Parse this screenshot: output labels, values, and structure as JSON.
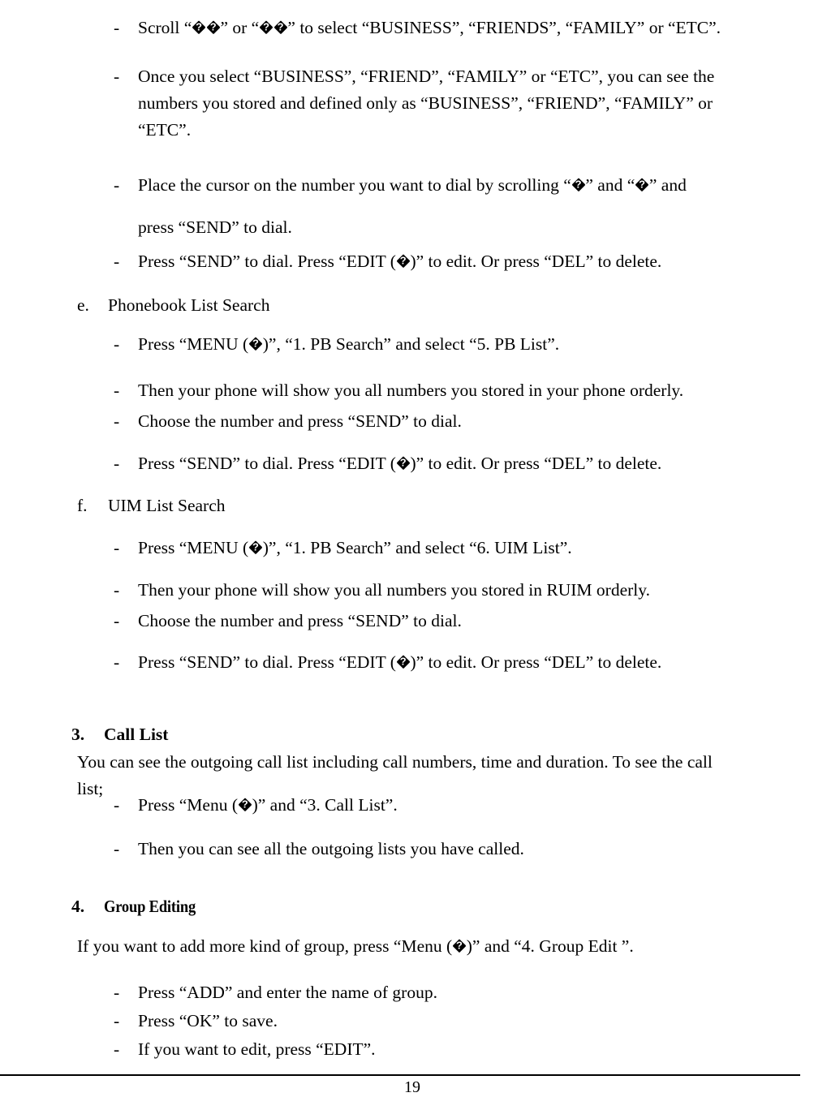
{
  "document": {
    "page_number": "19",
    "replacement_glyph": "�"
  },
  "body": {
    "items": [
      {
        "id": "scroll-select-group",
        "kind": "dash",
        "marker": "-",
        "segments": [
          {
            "t": "text",
            "v": "Scroll “"
          },
          {
            "t": "glyph"
          },
          {
            "t": "glyph"
          },
          {
            "t": "text",
            "v": "” or “"
          },
          {
            "t": "glyph"
          },
          {
            "t": "glyph"
          },
          {
            "t": "text",
            "v": "” to select “BUSINESS”, “FRIENDS”, “FAMILY” or “ETC”."
          }
        ],
        "plain": "Scroll “��” or “��” to select “BUSINESS”, “FRIENDS”, “FAMILY” or “ETC”."
      },
      {
        "id": "once-you-select",
        "kind": "dash",
        "marker": "-",
        "segments": [
          {
            "t": "text",
            "v": "Once you select “BUSINESS”, “FRIEND”, “FAMILY” or “ETC”, you can see the numbers you stored and defined only as “BUSINESS”, “FRIEND”, “FAMILY” or “ETC”."
          }
        ],
        "plain": "Once you select “BUSINESS”, “FRIEND”, “FAMILY” or “ETC”, you can see the numbers you stored and defined only as “BUSINESS”, “FRIEND”, “FAMILY” or “ETC”."
      },
      {
        "id": "place-cursor-dial",
        "kind": "dash",
        "marker": "-",
        "segments": [
          {
            "t": "text",
            "v": "Place the cursor on the number you want to dial by scrolling “"
          },
          {
            "t": "glyph"
          },
          {
            "t": "text",
            "v": "” and “"
          },
          {
            "t": "glyph"
          },
          {
            "t": "text",
            "v": "” and press “SEND” to dial."
          }
        ],
        "plain": "Place the cursor on the number you want to dial by scrolling “�” and “�” and press “SEND” to dial."
      },
      {
        "id": "press-send-edit-del-1",
        "kind": "dash",
        "marker": "-",
        "segments": [
          {
            "t": "text",
            "v": "Press “SEND” to dial. Press “EDIT ("
          },
          {
            "t": "glyph"
          },
          {
            "t": "text",
            "v": ")” to edit. Or press “DEL” to delete."
          }
        ],
        "plain": "Press “SEND” to dial. Press “EDIT (�)” to edit. Or press “DEL” to delete."
      },
      {
        "id": "section-e-heading",
        "kind": "letter",
        "marker": "e.",
        "segments": [
          {
            "t": "text",
            "v": "Phonebook List Search"
          }
        ],
        "plain": "Phonebook List Search"
      },
      {
        "id": "pb-list-menu-step",
        "kind": "dash",
        "marker": "-",
        "segments": [
          {
            "t": "text",
            "v": "Press “MENU ("
          },
          {
            "t": "glyph"
          },
          {
            "t": "text",
            "v": ")”, “1. PB Search” and select “5. PB List”."
          }
        ],
        "plain": "Press “MENU (�)”, “1. PB Search” and select “5. PB List”."
      },
      {
        "id": "pb-list-show-numbers",
        "kind": "dash",
        "marker": "-",
        "segments": [
          {
            "t": "text",
            "v": "Then your phone will show you all numbers you stored in your phone orderly."
          }
        ],
        "plain": "Then your phone will show you all numbers you stored in your phone orderly."
      },
      {
        "id": "pb-list-choose-number",
        "kind": "dash",
        "marker": "-",
        "segments": [
          {
            "t": "text",
            "v": "Choose the number and press “SEND” to dial."
          }
        ],
        "plain": "Choose the number and press “SEND” to dial."
      },
      {
        "id": "press-send-edit-del-2",
        "kind": "dash",
        "marker": "-",
        "segments": [
          {
            "t": "text",
            "v": "Press “SEND” to dial. Press “EDIT ("
          },
          {
            "t": "glyph"
          },
          {
            "t": "text",
            "v": ")” to edit. Or press “DEL” to delete."
          }
        ],
        "plain": "Press “SEND” to dial. Press “EDIT (�)” to edit. Or press “DEL” to delete."
      },
      {
        "id": "section-f-heading",
        "kind": "letter",
        "marker": "f.",
        "segments": [
          {
            "t": "text",
            "v": "UIM List Search"
          }
        ],
        "plain": "UIM List Search"
      },
      {
        "id": "uim-list-menu-step",
        "kind": "dash",
        "marker": "-",
        "segments": [
          {
            "t": "text",
            "v": "Press “MENU ("
          },
          {
            "t": "glyph"
          },
          {
            "t": "text",
            "v": ")”, “1. PB Search” and select “6. UIM List”."
          }
        ],
        "plain": "Press “MENU (�)”, “1. PB Search” and select “6. UIM List”."
      },
      {
        "id": "uim-list-show-numbers",
        "kind": "dash",
        "marker": "-",
        "segments": [
          {
            "t": "text",
            "v": "Then your phone will show you all numbers you stored in RUIM orderly."
          }
        ],
        "plain": "Then your phone will show you all numbers you stored in RUIM orderly."
      },
      {
        "id": "uim-list-choose-number",
        "kind": "dash",
        "marker": "-",
        "segments": [
          {
            "t": "text",
            "v": "Choose the number and press “SEND” to dial."
          }
        ],
        "plain": "Choose the number and press “SEND” to dial."
      },
      {
        "id": "press-send-edit-del-3",
        "kind": "dash",
        "marker": "-",
        "segments": [
          {
            "t": "text",
            "v": "Press “SEND” to dial. Press “EDIT ("
          },
          {
            "t": "glyph"
          },
          {
            "t": "text",
            "v": ")” to edit. Or press “DEL” to delete."
          }
        ],
        "plain": "Press “SEND” to dial. Press “EDIT (�)” to edit. Or press “DEL” to delete."
      },
      {
        "id": "section-3-heading",
        "kind": "number",
        "marker": "3.",
        "condensed": false,
        "segments": [
          {
            "t": "text",
            "v": "Call List"
          }
        ],
        "plain": "Call List"
      },
      {
        "id": "call-list-intro",
        "kind": "para",
        "segments": [
          {
            "t": "text",
            "v": "You can see the outgoing call list including call numbers, time and duration. To see the call list;"
          }
        ],
        "plain": "You can see the outgoing call list including call numbers, time and duration. To see the call list;"
      },
      {
        "id": "call-list-menu-step",
        "kind": "dash",
        "marker": "-",
        "segments": [
          {
            "t": "text",
            "v": "Press “Menu ("
          },
          {
            "t": "glyph"
          },
          {
            "t": "text",
            "v": ")” and “3. Call List”."
          }
        ],
        "plain": "Press “Menu (�)” and “3. Call List”."
      },
      {
        "id": "call-list-view-step",
        "kind": "dash",
        "marker": "-",
        "segments": [
          {
            "t": "text",
            "v": "Then you can see all the outgoing lists you have called."
          }
        ],
        "plain": "Then you can see all the outgoing lists you have called."
      },
      {
        "id": "section-4-heading",
        "kind": "number",
        "marker": "4.",
        "condensed": true,
        "segments": [
          {
            "t": "text",
            "v": "Group Editing"
          }
        ],
        "plain": "Group Editing"
      },
      {
        "id": "group-edit-intro",
        "kind": "para",
        "segments": [
          {
            "t": "text",
            "v": "If you want to add more kind of group, press “Menu ("
          },
          {
            "t": "glyph"
          },
          {
            "t": "text",
            "v": ")” and “4. Group Edit ”."
          }
        ],
        "plain": "If you want to add more kind of group, press “Menu (�)” and “4. Group Edit ”."
      },
      {
        "id": "group-edit-add",
        "kind": "dash",
        "marker": "-",
        "segments": [
          {
            "t": "text",
            "v": "Press “ADD” and enter the name of group."
          }
        ],
        "plain": "Press “ADD” and enter the name of group."
      },
      {
        "id": "group-edit-ok",
        "kind": "dash",
        "marker": "-",
        "segments": [
          {
            "t": "text",
            "v": "Press “OK” to save."
          }
        ],
        "plain": "Press “OK” to save."
      },
      {
        "id": "group-edit-edit",
        "kind": "dash",
        "marker": "-",
        "segments": [
          {
            "t": "text",
            "v": "If you want to edit, press “EDIT”."
          }
        ],
        "plain": "If you want to edit, press “EDIT”."
      }
    ]
  }
}
